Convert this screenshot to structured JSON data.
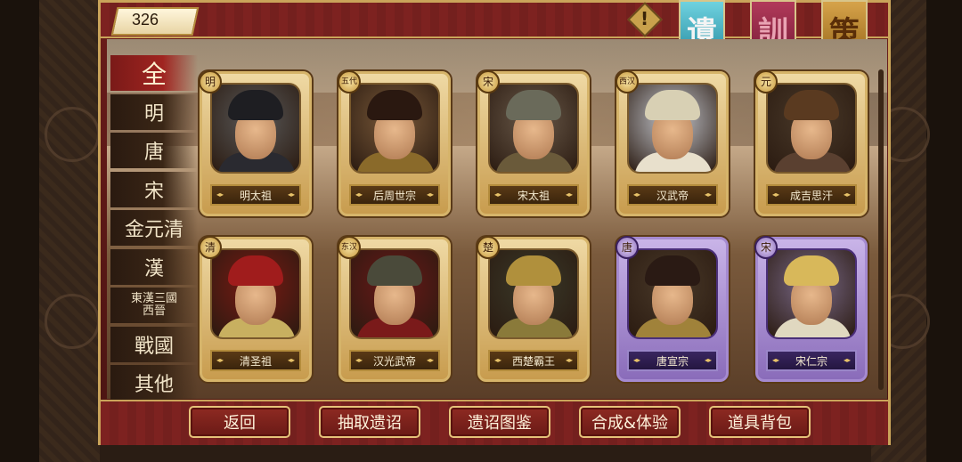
{
  "header": {
    "currency_value": "326",
    "alert_symbol": "!",
    "banners": [
      {
        "label": "遺",
        "color": "#2a8ea3"
      },
      {
        "label": "訓",
        "color": "#7a1c38"
      },
      {
        "label": "策",
        "color": "#9a6a1c"
      }
    ]
  },
  "dynasty_tabs": [
    {
      "label": "全",
      "active": true
    },
    {
      "label": "明"
    },
    {
      "label": "唐"
    },
    {
      "label": "宋"
    },
    {
      "label": "金元清"
    },
    {
      "label": "漢"
    },
    {
      "label": "東漢三國\n西晉"
    },
    {
      "label": "戰國"
    },
    {
      "label": "其他"
    }
  ],
  "cards": [
    {
      "badge": "明",
      "name": "明太祖",
      "rarity": "gold",
      "icon": "emperor-portrait"
    },
    {
      "badge": "五代",
      "name": "后周世宗",
      "rarity": "gold",
      "icon": "emperor-portrait"
    },
    {
      "badge": "宋",
      "name": "宋太祖",
      "rarity": "gold",
      "icon": "emperor-portrait"
    },
    {
      "badge": "西汉",
      "name": "汉武帝",
      "rarity": "gold",
      "icon": "emperor-portrait"
    },
    {
      "badge": "元",
      "name": "成吉思汗",
      "rarity": "gold",
      "icon": "emperor-portrait"
    },
    {
      "badge": "清",
      "name": "清圣祖",
      "rarity": "gold",
      "icon": "emperor-portrait"
    },
    {
      "badge": "东汉",
      "name": "汉光武帝",
      "rarity": "gold",
      "icon": "emperor-portrait"
    },
    {
      "badge": "楚",
      "name": "西楚霸王",
      "rarity": "gold",
      "icon": "emperor-portrait"
    },
    {
      "badge": "唐",
      "name": "唐宣宗",
      "rarity": "purple",
      "icon": "emperor-portrait"
    },
    {
      "badge": "宋",
      "name": "宋仁宗",
      "rarity": "purple",
      "icon": "emperor-portrait"
    }
  ],
  "footer": {
    "back": "返回",
    "draw": "抽取遗诏",
    "gallery": "遗诏图鉴",
    "compose": "合成&体验",
    "inventory": "道具背包"
  },
  "colors": {
    "frame_red": "#7d2220",
    "gold_border": "#caa45a",
    "purple_card": "#8a6cba"
  }
}
